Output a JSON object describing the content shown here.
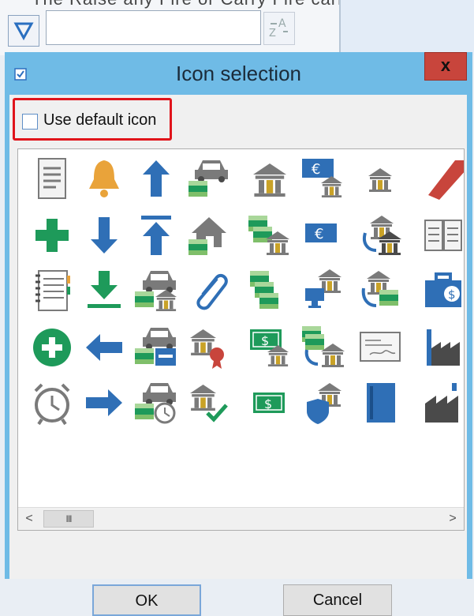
{
  "background": {
    "cut_text": "The Raise any Fire or Carry Fire carry",
    "filter_icon": "filter-icon",
    "translate_icon": "translate-icon",
    "input_value": ""
  },
  "dialog": {
    "title": "Icon selection",
    "close_label": "x",
    "default_icon_label": "Use default icon",
    "default_icon_checked": false,
    "ok_label": "OK",
    "cancel_label": "Cancel",
    "scroll_thumb_glyph": "III",
    "scroll_left_glyph": "<",
    "scroll_right_glyph": ">"
  },
  "icons": [
    [
      "document-list-icon",
      "bell-icon",
      "arrow-up-icon",
      "car-money-icon",
      "bank-icon",
      "euro-bank-icon",
      "bank-small-icon",
      "ribbon-icon"
    ],
    [
      "plus-icon",
      "arrow-down-icon",
      "arrow-up-top-icon",
      "house-money-icon",
      "money-bank-icon",
      "euro-note-icon",
      "bank-transfer-icon",
      "book-open-icon"
    ],
    [
      "notebook-icon",
      "download-icon",
      "car-money-bank-icon",
      "paperclip-icon",
      "money-stack-icon",
      "bank-computer-icon",
      "bank-transfer-money-icon",
      "briefcase-dollar-icon"
    ],
    [
      "plus-circle-icon",
      "arrow-left-icon",
      "car-money-card-icon",
      "bank-award-icon",
      "dollar-bank-icon",
      "money-bank-transfer-icon",
      "cheque-icon",
      "factory-icon"
    ],
    [
      "alarm-clock-icon",
      "arrow-right-icon",
      "car-money-clock-icon",
      "bank-check-icon",
      "dollar-note-icon",
      "bank-shield-icon",
      "book-closed-icon",
      "factory-dark-icon"
    ]
  ]
}
